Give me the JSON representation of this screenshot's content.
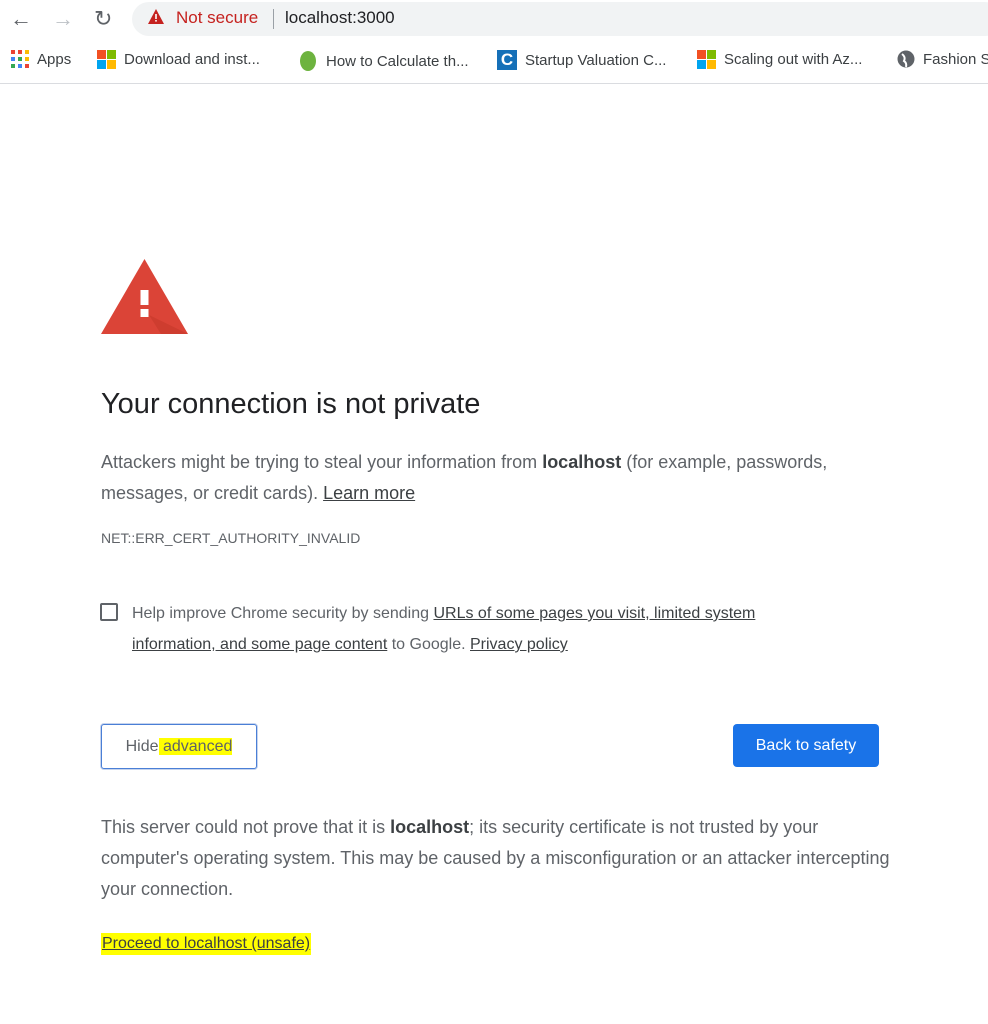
{
  "browser": {
    "address": {
      "security_label": "Not secure",
      "url": "localhost:3000"
    },
    "bookmarks": [
      {
        "label": "Apps",
        "icon": "apps-grid-icon"
      },
      {
        "label": "Download and inst...",
        "icon": "microsoft-logo-icon"
      },
      {
        "label": "How to Calculate th...",
        "icon": "leaf-icon"
      },
      {
        "label": "Startup Valuation C...",
        "icon": "c-logo-icon"
      },
      {
        "label": "Scaling out with Az...",
        "icon": "microsoft-logo-icon"
      },
      {
        "label": "Fashion S",
        "icon": "globe-icon"
      }
    ]
  },
  "page": {
    "title": "Your connection is not private",
    "intro_pre": "Attackers might be trying to steal your information from ",
    "host": "localhost",
    "intro_post": " (for example, passwords, messages, or credit cards). ",
    "learn_more": "Learn more",
    "error_code": "NET::ERR_CERT_AUTHORITY_INVALID",
    "checkbox": {
      "pre": "Help improve Chrome security by sending ",
      "link1": "URLs of some pages you visit, limited system information, and some page content",
      "mid": " to Google. ",
      "link2": "Privacy policy",
      "checked": false
    },
    "hide_advanced_a": "Hide",
    "hide_advanced_b": " advanced",
    "back_to_safety": "Back to safety",
    "details_pre": "This server could not prove that it is ",
    "details_post": "; its security certificate is not trusted by your computer's operating system. This may be caused by a misconfiguration or an attacker intercepting your connection.",
    "proceed": "Proceed to localhost (unsafe)"
  },
  "colors": {
    "accent": "#1a73e8",
    "danger": "#d93025",
    "highlight": "#ffff00"
  }
}
